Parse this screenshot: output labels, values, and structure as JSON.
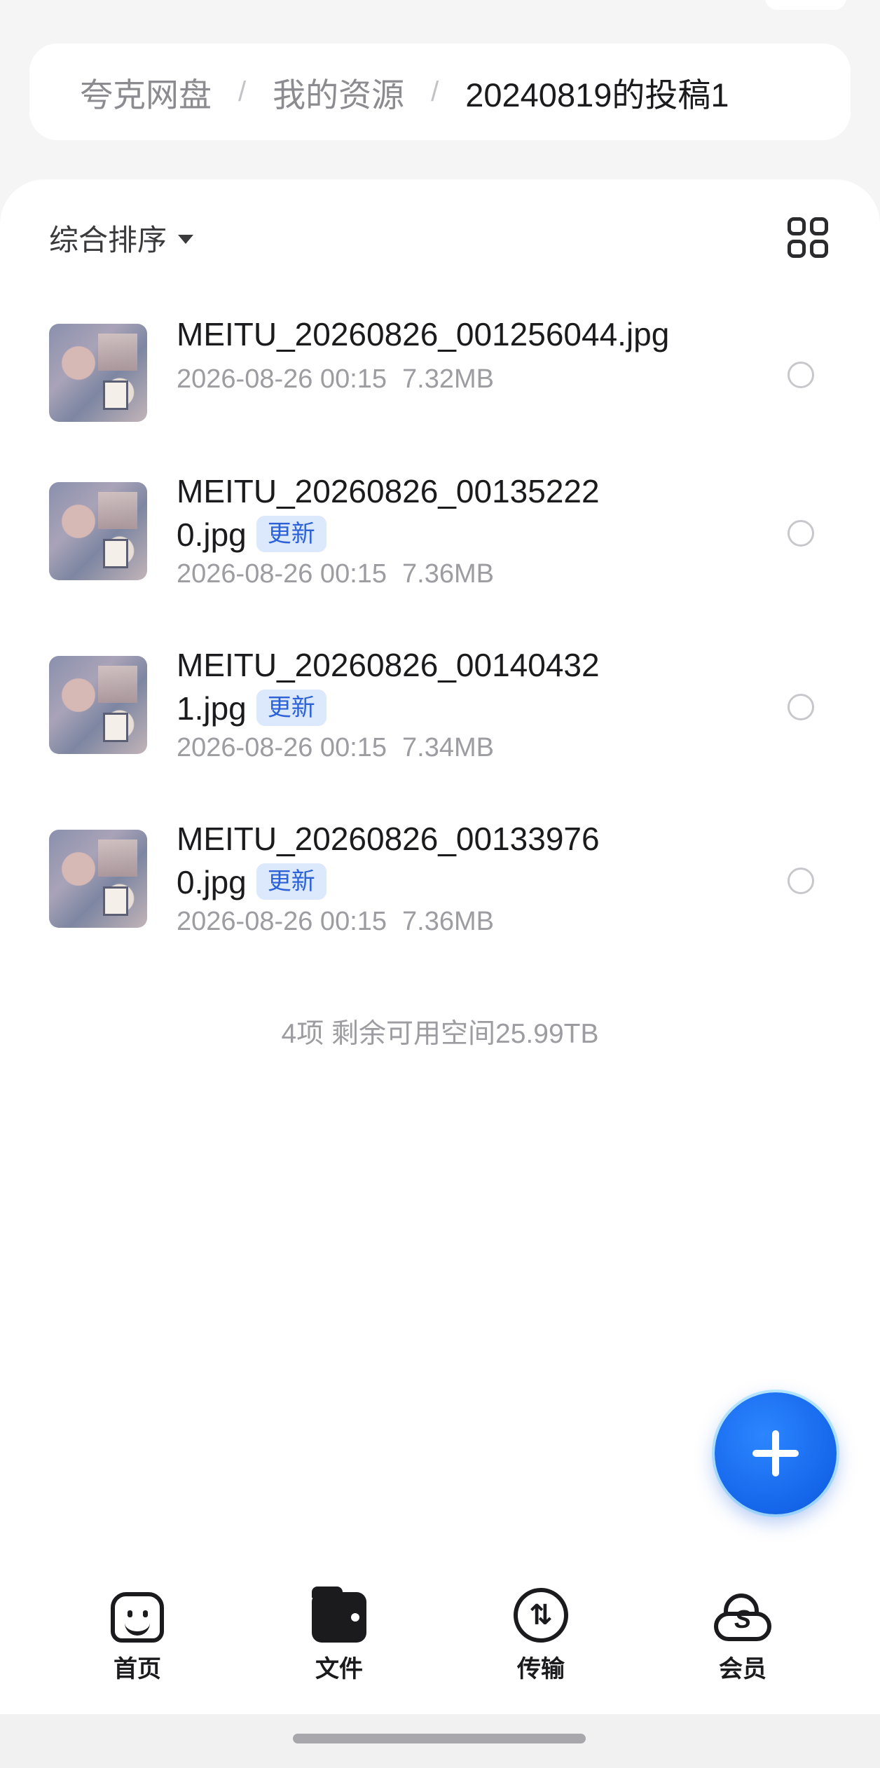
{
  "breadcrumb": {
    "items": [
      "夸克网盘",
      "我的资源",
      "20240819的投稿1"
    ],
    "separator": "/"
  },
  "toolbar": {
    "sort_label": "综合排序",
    "view_toggle_icon": "grid-view-icon"
  },
  "files": [
    {
      "name": "MEITU_20260826_001256044.jpg",
      "badge": "",
      "date": "2026-08-26 00:15",
      "size": "7.32MB"
    },
    {
      "name_line1": "MEITU_20260826_00135222",
      "name_line2": "0.jpg",
      "badge": "更新",
      "date": "2026-08-26 00:15",
      "size": "7.36MB"
    },
    {
      "name_line1": "MEITU_20260826_00140432",
      "name_line2": "1.jpg",
      "badge": "更新",
      "date": "2026-08-26 00:15",
      "size": "7.34MB"
    },
    {
      "name_line1": "MEITU_20260826_00133976",
      "name_line2": "0.jpg",
      "badge": "更新",
      "date": "2026-08-26 00:15",
      "size": "7.36MB"
    }
  ],
  "summary": "4项 剩余可用空间25.99TB",
  "fab": {
    "icon": "plus-icon",
    "color": "#1566ea"
  },
  "bottom_nav": [
    {
      "label": "首页",
      "icon": "home-smile-icon"
    },
    {
      "label": "文件",
      "icon": "folder-icon"
    },
    {
      "label": "传输",
      "icon": "transfer-icon"
    },
    {
      "label": "会员",
      "icon": "member-cloud-icon"
    }
  ],
  "colors": {
    "accent": "#1566ea",
    "badge_bg": "#dce8fc",
    "badge_text": "#2c62d6"
  }
}
